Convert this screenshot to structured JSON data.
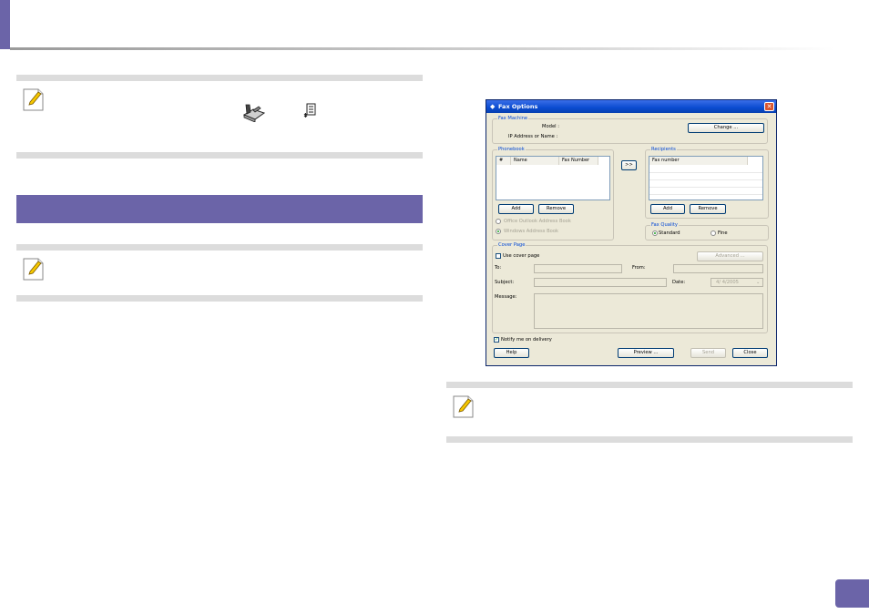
{
  "page": {
    "badge_number": ""
  },
  "dialog": {
    "title": "Fax Options",
    "close_glyph": "✕",
    "fax_machine": {
      "group_label": "Fax Machine",
      "model_label": "Model :",
      "ip_label": "IP Address or Name :",
      "change_button": "Change ..."
    },
    "phonebook": {
      "group_label": "Phonebook",
      "columns": [
        "#",
        "Name",
        "Fax Number"
      ],
      "add_button": "Add",
      "remove_button": "Remove",
      "outlook_option": "Office Outlook Address Book",
      "windows_option": "Windows Address Book"
    },
    "transfer_button": ">>",
    "recipients": {
      "group_label": "Recipients",
      "columns": [
        "Fax number"
      ],
      "add_button": "Add",
      "remove_button": "Remove"
    },
    "fax_quality": {
      "group_label": "Fax Quality",
      "standard": "Standard",
      "fine": "Fine",
      "selected": "Standard"
    },
    "cover_page": {
      "group_label": "Cover Page",
      "use_cover_page": "Use cover page",
      "use_cover_page_checked": false,
      "advanced_button": "Advanced ...",
      "to_label": "To:",
      "from_label": "From:",
      "subject_label": "Subject:",
      "date_label": "Date:",
      "date_value": "4/ 4/2005",
      "message_label": "Message:"
    },
    "notify": {
      "label": "Notify me on delivery",
      "checked": true
    },
    "buttons": {
      "help": "Help",
      "preview": "Preview ...",
      "send": "Send",
      "close": "Close"
    }
  },
  "icons": {
    "note": "note-pencil-icon",
    "fax_tray": "fax-machine-icon",
    "properties": "properties-sheet-icon"
  },
  "colors": {
    "accent": "#6b64a8",
    "note_border": "#dcdcdc",
    "dialog_title": "#0a4bd0",
    "group_label": "#0046d5"
  }
}
